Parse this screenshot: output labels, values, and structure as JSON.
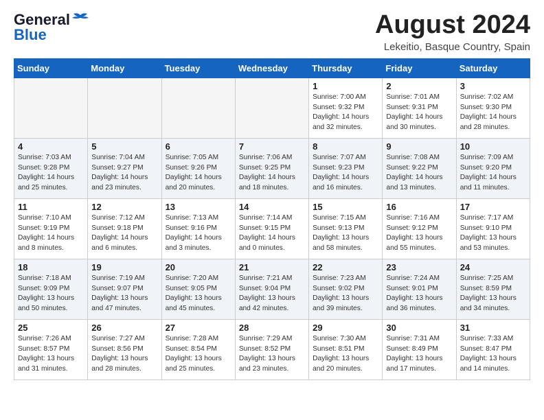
{
  "header": {
    "logo_general": "General",
    "logo_blue": "Blue",
    "month_title": "August 2024",
    "location": "Lekeitio, Basque Country, Spain"
  },
  "weekdays": [
    "Sunday",
    "Monday",
    "Tuesday",
    "Wednesday",
    "Thursday",
    "Friday",
    "Saturday"
  ],
  "weeks": [
    [
      {
        "day": "",
        "detail": "",
        "empty": true
      },
      {
        "day": "",
        "detail": "",
        "empty": true
      },
      {
        "day": "",
        "detail": "",
        "empty": true
      },
      {
        "day": "",
        "detail": "",
        "empty": true
      },
      {
        "day": "1",
        "detail": "Sunrise: 7:00 AM\nSunset: 9:32 PM\nDaylight: 14 hours\nand 32 minutes.",
        "empty": false
      },
      {
        "day": "2",
        "detail": "Sunrise: 7:01 AM\nSunset: 9:31 PM\nDaylight: 14 hours\nand 30 minutes.",
        "empty": false
      },
      {
        "day": "3",
        "detail": "Sunrise: 7:02 AM\nSunset: 9:30 PM\nDaylight: 14 hours\nand 28 minutes.",
        "empty": false
      }
    ],
    [
      {
        "day": "4",
        "detail": "Sunrise: 7:03 AM\nSunset: 9:28 PM\nDaylight: 14 hours\nand 25 minutes.",
        "empty": false
      },
      {
        "day": "5",
        "detail": "Sunrise: 7:04 AM\nSunset: 9:27 PM\nDaylight: 14 hours\nand 23 minutes.",
        "empty": false
      },
      {
        "day": "6",
        "detail": "Sunrise: 7:05 AM\nSunset: 9:26 PM\nDaylight: 14 hours\nand 20 minutes.",
        "empty": false
      },
      {
        "day": "7",
        "detail": "Sunrise: 7:06 AM\nSunset: 9:25 PM\nDaylight: 14 hours\nand 18 minutes.",
        "empty": false
      },
      {
        "day": "8",
        "detail": "Sunrise: 7:07 AM\nSunset: 9:23 PM\nDaylight: 14 hours\nand 16 minutes.",
        "empty": false
      },
      {
        "day": "9",
        "detail": "Sunrise: 7:08 AM\nSunset: 9:22 PM\nDaylight: 14 hours\nand 13 minutes.",
        "empty": false
      },
      {
        "day": "10",
        "detail": "Sunrise: 7:09 AM\nSunset: 9:20 PM\nDaylight: 14 hours\nand 11 minutes.",
        "empty": false
      }
    ],
    [
      {
        "day": "11",
        "detail": "Sunrise: 7:10 AM\nSunset: 9:19 PM\nDaylight: 14 hours\nand 8 minutes.",
        "empty": false
      },
      {
        "day": "12",
        "detail": "Sunrise: 7:12 AM\nSunset: 9:18 PM\nDaylight: 14 hours\nand 6 minutes.",
        "empty": false
      },
      {
        "day": "13",
        "detail": "Sunrise: 7:13 AM\nSunset: 9:16 PM\nDaylight: 14 hours\nand 3 minutes.",
        "empty": false
      },
      {
        "day": "14",
        "detail": "Sunrise: 7:14 AM\nSunset: 9:15 PM\nDaylight: 14 hours\nand 0 minutes.",
        "empty": false
      },
      {
        "day": "15",
        "detail": "Sunrise: 7:15 AM\nSunset: 9:13 PM\nDaylight: 13 hours\nand 58 minutes.",
        "empty": false
      },
      {
        "day": "16",
        "detail": "Sunrise: 7:16 AM\nSunset: 9:12 PM\nDaylight: 13 hours\nand 55 minutes.",
        "empty": false
      },
      {
        "day": "17",
        "detail": "Sunrise: 7:17 AM\nSunset: 9:10 PM\nDaylight: 13 hours\nand 53 minutes.",
        "empty": false
      }
    ],
    [
      {
        "day": "18",
        "detail": "Sunrise: 7:18 AM\nSunset: 9:09 PM\nDaylight: 13 hours\nand 50 minutes.",
        "empty": false
      },
      {
        "day": "19",
        "detail": "Sunrise: 7:19 AM\nSunset: 9:07 PM\nDaylight: 13 hours\nand 47 minutes.",
        "empty": false
      },
      {
        "day": "20",
        "detail": "Sunrise: 7:20 AM\nSunset: 9:05 PM\nDaylight: 13 hours\nand 45 minutes.",
        "empty": false
      },
      {
        "day": "21",
        "detail": "Sunrise: 7:21 AM\nSunset: 9:04 PM\nDaylight: 13 hours\nand 42 minutes.",
        "empty": false
      },
      {
        "day": "22",
        "detail": "Sunrise: 7:23 AM\nSunset: 9:02 PM\nDaylight: 13 hours\nand 39 minutes.",
        "empty": false
      },
      {
        "day": "23",
        "detail": "Sunrise: 7:24 AM\nSunset: 9:01 PM\nDaylight: 13 hours\nand 36 minutes.",
        "empty": false
      },
      {
        "day": "24",
        "detail": "Sunrise: 7:25 AM\nSunset: 8:59 PM\nDaylight: 13 hours\nand 34 minutes.",
        "empty": false
      }
    ],
    [
      {
        "day": "25",
        "detail": "Sunrise: 7:26 AM\nSunset: 8:57 PM\nDaylight: 13 hours\nand 31 minutes.",
        "empty": false
      },
      {
        "day": "26",
        "detail": "Sunrise: 7:27 AM\nSunset: 8:56 PM\nDaylight: 13 hours\nand 28 minutes.",
        "empty": false
      },
      {
        "day": "27",
        "detail": "Sunrise: 7:28 AM\nSunset: 8:54 PM\nDaylight: 13 hours\nand 25 minutes.",
        "empty": false
      },
      {
        "day": "28",
        "detail": "Sunrise: 7:29 AM\nSunset: 8:52 PM\nDaylight: 13 hours\nand 23 minutes.",
        "empty": false
      },
      {
        "day": "29",
        "detail": "Sunrise: 7:30 AM\nSunset: 8:51 PM\nDaylight: 13 hours\nand 20 minutes.",
        "empty": false
      },
      {
        "day": "30",
        "detail": "Sunrise: 7:31 AM\nSunset: 8:49 PM\nDaylight: 13 hours\nand 17 minutes.",
        "empty": false
      },
      {
        "day": "31",
        "detail": "Sunrise: 7:33 AM\nSunset: 8:47 PM\nDaylight: 13 hours\nand 14 minutes.",
        "empty": false
      }
    ]
  ],
  "row_classes": [
    "row-light",
    "row-dark",
    "row-light",
    "row-dark",
    "row-light"
  ]
}
